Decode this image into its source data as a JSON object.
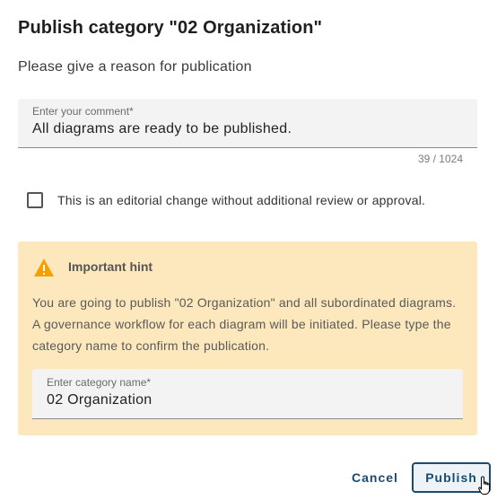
{
  "dialog": {
    "title": "Publish category \"02 Organization\"",
    "subtitle": "Please give a reason for publication"
  },
  "comment": {
    "label": "Enter your comment*",
    "value": "All diagrams are ready to be published.",
    "counter": "39 / 1024"
  },
  "editorial": {
    "checked": false,
    "label": "This is an editorial change without additional review or approval."
  },
  "hint": {
    "title": "Important hint",
    "text": "You are going to publish \"02 Organization\" and all subordinated diagrams. A governance workflow for each diagram will be initiated. Please type the category name to confirm the publication.",
    "icon": "warning-icon",
    "color": "#f5a000",
    "background": "#fde8bd"
  },
  "category": {
    "label": "Enter category name*",
    "value": "02 Organization"
  },
  "actions": {
    "cancel_label": "Cancel",
    "publish_label": "Publish",
    "accent": "#1a4a6e"
  }
}
